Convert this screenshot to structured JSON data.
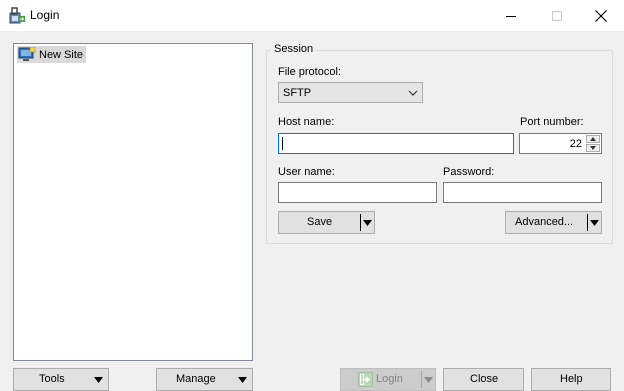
{
  "window": {
    "title": "Login",
    "app_icon": "winscp-login-icon",
    "controls": [
      "minimize-icon",
      "maximize-icon",
      "close-icon"
    ]
  },
  "site_tree": {
    "items": [
      {
        "label": "New Site",
        "icon": "computer-icon",
        "selected": true
      }
    ]
  },
  "session": {
    "group_label": "Session",
    "file_protocol": {
      "label": "File protocol:",
      "value": "SFTP"
    },
    "host_name": {
      "label": "Host name:",
      "value": ""
    },
    "port_number": {
      "label": "Port number:",
      "value": "22"
    },
    "user_name": {
      "label": "User name:",
      "value": ""
    },
    "password": {
      "label": "Password:",
      "value": ""
    },
    "save_label": "Save",
    "advanced_label": "Advanced..."
  },
  "footer": {
    "tools_label": "Tools",
    "manage_label": "Manage",
    "login_label": "Login",
    "close_label": "Close",
    "help_label": "Help"
  },
  "colors": {
    "window_bg": "#f0f0f0",
    "focus_border": "#0078d7",
    "tree_selection": "#d9d9d9"
  }
}
